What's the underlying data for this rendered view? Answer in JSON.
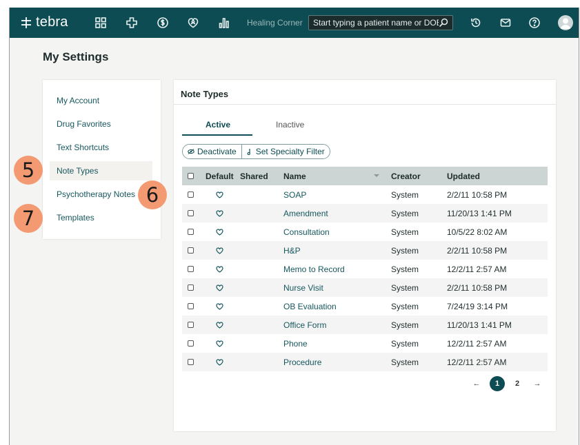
{
  "header": {
    "brand": "tebra",
    "practice_name": "Healing Corner",
    "search_placeholder": "Start typing a patient name or DOB",
    "nav_icons": [
      "dashboard-icon",
      "medical-cross-icon",
      "billing-dollar-icon",
      "patient-engagement-icon",
      "reports-chart-icon"
    ],
    "right_icons": [
      "history-icon",
      "mail-icon",
      "help-icon",
      "user-avatar-icon"
    ]
  },
  "page": {
    "title": "My Settings"
  },
  "menu": {
    "items": [
      {
        "label": "My Account"
      },
      {
        "label": "Drug Favorites"
      },
      {
        "label": "Text Shortcuts"
      },
      {
        "label": "Note Types",
        "selected": true
      },
      {
        "label": "Psychotherapy Notes"
      },
      {
        "label": "Templates"
      }
    ]
  },
  "panel": {
    "title": "Note Types",
    "tabs": [
      {
        "label": "Active",
        "active": true
      },
      {
        "label": "Inactive"
      }
    ],
    "actions": {
      "deactivate": "Deactivate",
      "specialty_filter": "Set Specialty Filter"
    },
    "columns": {
      "default": "Default",
      "shared": "Shared",
      "name": "Name",
      "creator": "Creator",
      "updated": "Updated"
    },
    "rows": [
      {
        "name": "SOAP",
        "creator": "System",
        "updated": "2/2/11 10:58 PM"
      },
      {
        "name": "Amendment",
        "creator": "System",
        "updated": "11/20/13 1:41 PM"
      },
      {
        "name": "Consultation",
        "creator": "System",
        "updated": "10/5/22 8:02 AM"
      },
      {
        "name": "H&P",
        "creator": "System",
        "updated": "2/2/11 10:58 PM"
      },
      {
        "name": "Memo to Record",
        "creator": "System",
        "updated": "12/2/11 2:57 AM"
      },
      {
        "name": "Nurse Visit",
        "creator": "System",
        "updated": "2/2/11 10:58 PM"
      },
      {
        "name": "OB Evaluation",
        "creator": "System",
        "updated": "7/24/19 3:14 PM"
      },
      {
        "name": "Office Form",
        "creator": "System",
        "updated": "11/20/13 1:41 PM"
      },
      {
        "name": "Phone",
        "creator": "System",
        "updated": "12/2/11 2:57 AM"
      },
      {
        "name": "Procedure",
        "creator": "System",
        "updated": "12/2/11 2:57 AM"
      }
    ],
    "pagination": {
      "current": "1",
      "next_page": "2"
    }
  },
  "callouts": {
    "five": "5",
    "six": "6",
    "seven": "7"
  },
  "colors": {
    "brand_teal": "#0d4c52",
    "callout": "#f49a72",
    "header_row": "#ccd5d4"
  }
}
